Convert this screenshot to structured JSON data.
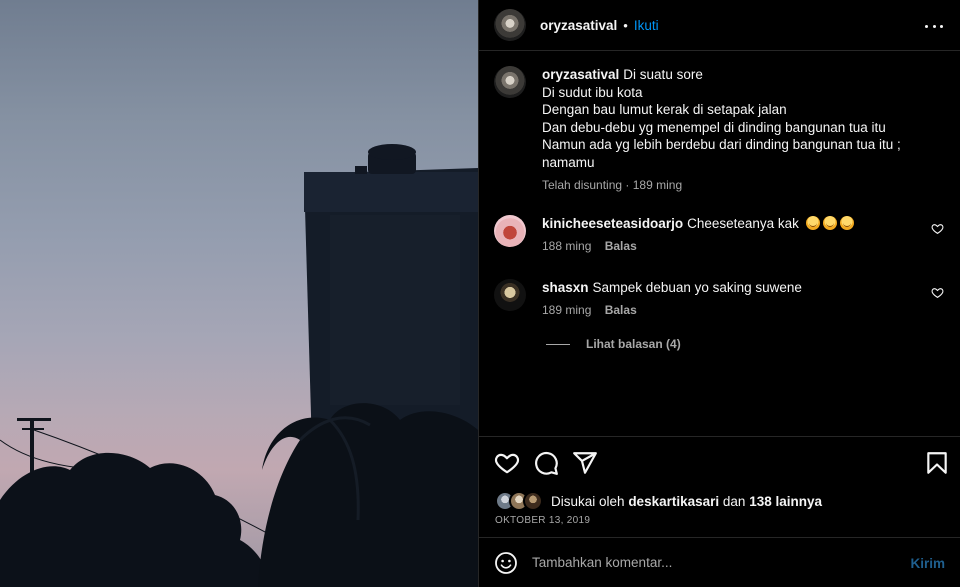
{
  "post": {
    "username": "oryzasatival",
    "separator": "•",
    "follow_label": "Ikuti"
  },
  "caption": {
    "username": "oryzasatival",
    "lines": [
      "Di suatu sore",
      "Di sudut ibu kota",
      "Dengan bau lumut kerak di setapak jalan",
      "Dan debu-debu yg menempel di dinding bangunan tua itu",
      "Namun ada yg lebih berdebu dari dinding bangunan tua itu ;",
      "namamu"
    ],
    "edited_label": "Telah disunting",
    "meta_separator": "·",
    "time": "189 ming"
  },
  "comments": [
    {
      "username": "kinicheeseteasidoarjo",
      "text": "Cheeseteanya kak",
      "emojis": [
        "smiling-face-icon",
        "smiling-face-icon",
        "smiling-face-icon"
      ],
      "time": "188 ming",
      "reply_label": "Balas"
    },
    {
      "username": "shasxn",
      "text": "Sampek debuan yo saking suwene",
      "time": "189 ming",
      "reply_label": "Balas",
      "view_replies_label": "Lihat balasan (4)"
    }
  ],
  "likes": {
    "prefix": "Disukai oleh",
    "liker": "deskartikasari",
    "conjunction": "dan",
    "others": "138 lainnya"
  },
  "date": "OKTOBER 13, 2019",
  "composer": {
    "placeholder": "Tambahkan komentar...",
    "post_label": "Kirim"
  },
  "icons": {
    "like": "heart-icon",
    "comment": "comment-icon",
    "share": "send-icon",
    "save": "bookmark-icon",
    "more": "more-options-icon",
    "emoji": "emoji-icon"
  },
  "colors": {
    "accent": "#0095f6",
    "post_button_disabled": "#1f5f8e",
    "secondary_text": "#a8a8a8",
    "divider": "#262626"
  }
}
